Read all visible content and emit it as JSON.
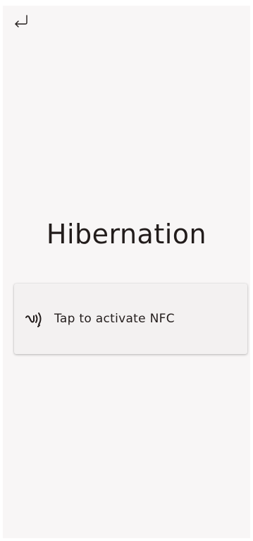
{
  "screen": {
    "title": "Hibernation",
    "back_icon": "return-arrow-icon",
    "nfc_card": {
      "icon": "nfc-icon",
      "label": "Tap to activate NFC"
    }
  },
  "colors": {
    "background": "#f8f6f6",
    "card": "#f3f1f1",
    "text": "#231d1c"
  }
}
